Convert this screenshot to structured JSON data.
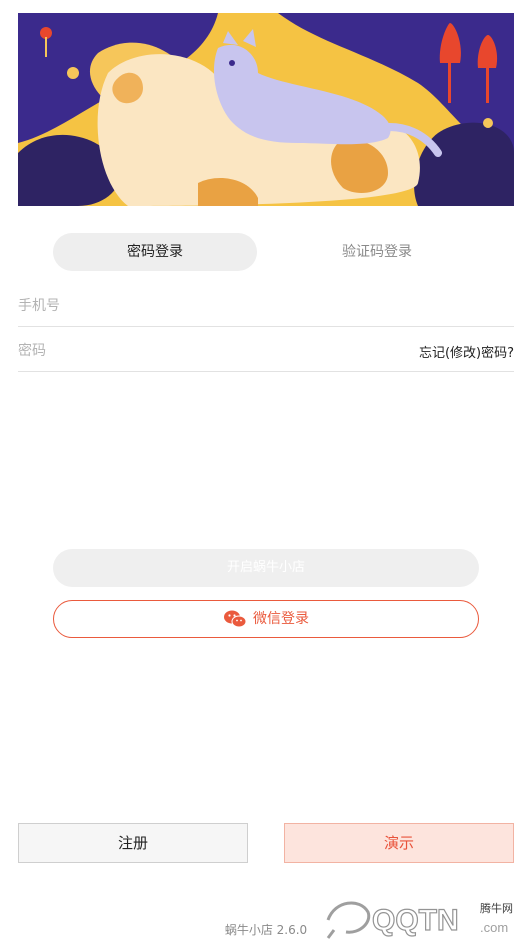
{
  "tabs": {
    "password": "密码登录",
    "sms_code": "验证码登录"
  },
  "form": {
    "phone_placeholder": "手机号",
    "password_placeholder": "密码",
    "forgot_label": "忘记(修改)密码?"
  },
  "buttons": {
    "open_store": "开启蜗牛小店",
    "wechat_login": "微信登录",
    "register": "注册",
    "demo": "演示"
  },
  "footer": {
    "version": "蜗牛小店 2.6.0"
  },
  "watermark": {
    "brand": "QQTN",
    "site": "腾牛网",
    "suffix": ".com"
  },
  "colors": {
    "accent": "#ea5a3d",
    "tab_bg": "#eeeeee"
  }
}
